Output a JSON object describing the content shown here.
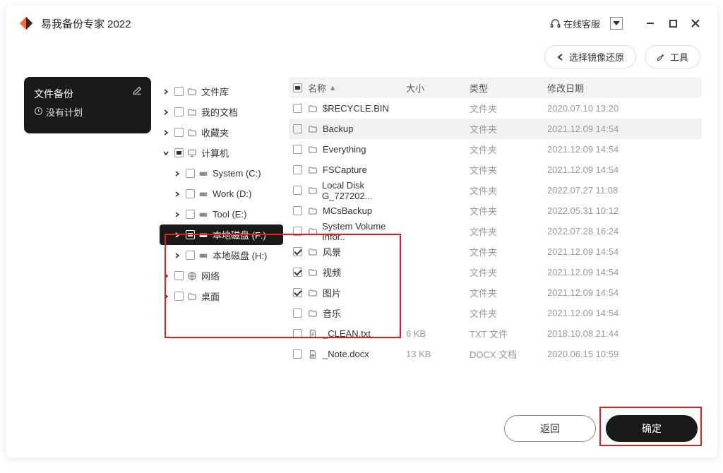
{
  "app": {
    "title": "易我备份专家 2022"
  },
  "titlebar": {
    "online_support": "在线客服"
  },
  "toolbar": {
    "restore_image": "选择镜像还原",
    "tools": "工具"
  },
  "side_card": {
    "title": "文件备份",
    "subtitle": "没有计划"
  },
  "tree": [
    {
      "depth": 0,
      "chev": "right",
      "chk": "",
      "icon": "folder",
      "label": "文件库"
    },
    {
      "depth": 0,
      "chev": "right",
      "chk": "",
      "icon": "folder",
      "label": "我的文档"
    },
    {
      "depth": 0,
      "chev": "right",
      "chk": "",
      "icon": "folder",
      "label": "收藏夹"
    },
    {
      "depth": 0,
      "chev": "down",
      "chk": "ind",
      "icon": "pc",
      "label": "计算机"
    },
    {
      "depth": 1,
      "chev": "right",
      "chk": "",
      "icon": "drive",
      "label": "System (C:)"
    },
    {
      "depth": 1,
      "chev": "right",
      "chk": "",
      "icon": "drive",
      "label": "Work (D:)"
    },
    {
      "depth": 1,
      "chev": "right",
      "chk": "",
      "icon": "drive",
      "label": "Tool (E:)"
    },
    {
      "depth": 1,
      "chev": "right",
      "chk": "ind",
      "icon": "drive",
      "label": "本地磁盘 (F:)",
      "selected": true
    },
    {
      "depth": 1,
      "chev": "right",
      "chk": "",
      "icon": "drive",
      "label": "本地磁盘 (H:)"
    },
    {
      "depth": 0,
      "chev": "right",
      "chk": "",
      "icon": "net",
      "label": "网络"
    },
    {
      "depth": 0,
      "chev": "right",
      "chk": "",
      "icon": "folder",
      "label": "桌面"
    }
  ],
  "table": {
    "headers": {
      "name": "名称",
      "size": "大小",
      "type": "类型",
      "date": "修改日期"
    },
    "rows": [
      {
        "chk": "",
        "icon": "folder",
        "name": "$RECYCLE.BIN",
        "size": "",
        "type": "文件夹",
        "date": "2020.07.10 13:20"
      },
      {
        "chk": "",
        "icon": "folder",
        "name": "Backup",
        "size": "",
        "type": "文件夹",
        "date": "2021.12.09 14:54",
        "highlight": true
      },
      {
        "chk": "",
        "icon": "folder",
        "name": "Everything",
        "size": "",
        "type": "文件夹",
        "date": "2021.12.09 14:54"
      },
      {
        "chk": "",
        "icon": "folder",
        "name": "FSCapture",
        "size": "",
        "type": "文件夹",
        "date": "2021.12.09 14:54"
      },
      {
        "chk": "",
        "icon": "folder",
        "name": "Local Disk G_727202...",
        "size": "",
        "type": "文件夹",
        "date": "2022.07.27 11:08"
      },
      {
        "chk": "",
        "icon": "folder",
        "name": "MCsBackup",
        "size": "",
        "type": "文件夹",
        "date": "2022.05.31 10:12"
      },
      {
        "chk": "",
        "icon": "folder",
        "name": "System Volume Infor..",
        "size": "",
        "type": "文件夹",
        "date": "2022.07.28 16:24"
      },
      {
        "chk": "checked",
        "icon": "folder",
        "name": "风景",
        "size": "",
        "type": "文件夹",
        "date": "2021.12.09 14:54"
      },
      {
        "chk": "checked",
        "icon": "folder",
        "name": "视频",
        "size": "",
        "type": "文件夹",
        "date": "2021.12.09 14:54"
      },
      {
        "chk": "checked",
        "icon": "folder",
        "name": "图片",
        "size": "",
        "type": "文件夹",
        "date": "2021.12.09 14:54"
      },
      {
        "chk": "",
        "icon": "folder",
        "name": "音乐",
        "size": "",
        "type": "文件夹",
        "date": "2021.12.09 14:54"
      },
      {
        "chk": "",
        "icon": "txt",
        "name": "_CLEAN.txt",
        "size": "6 KB",
        "type": "TXT 文件",
        "date": "2018.10.08 21:44"
      },
      {
        "chk": "",
        "icon": "docx",
        "name": "_Note.docx",
        "size": "13 KB",
        "type": "DOCX 文档",
        "date": "2020.06.15 10:59"
      }
    ]
  },
  "footer": {
    "back": "返回",
    "ok": "确定"
  }
}
